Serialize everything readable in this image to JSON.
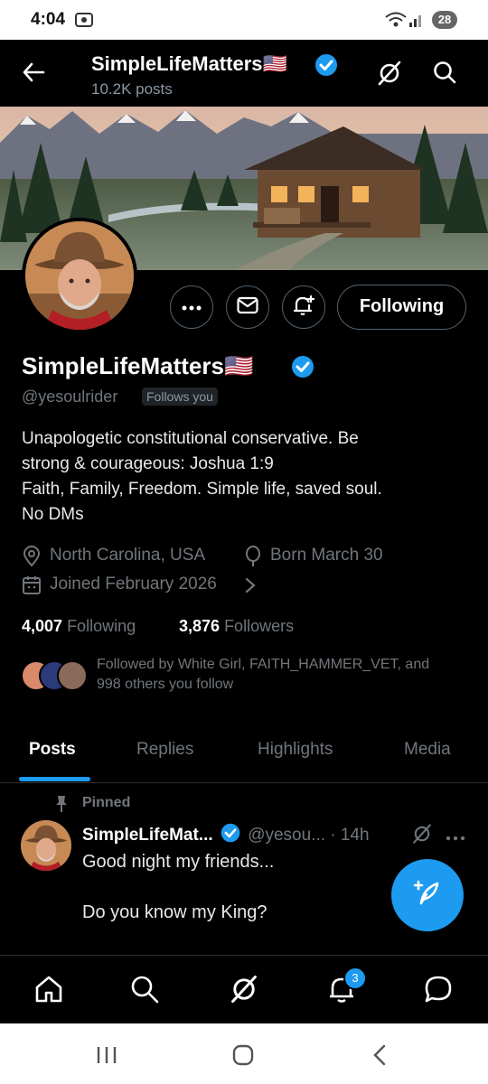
{
  "status_bar": {
    "time": "4:04",
    "battery": "28"
  },
  "header": {
    "title": "SimpleLifeMatters🇺🇸",
    "posts_count": "10.2K posts"
  },
  "profile": {
    "display_name": "SimpleLifeMatters🇺🇸",
    "handle": "@yesoulrider",
    "follows_you": "Follows you",
    "following_button": "Following",
    "bio": [
      "Unapologetic constitutional conservative. Be",
      "strong & courageous: Joshua 1:9",
      "Faith, Family, Freedom. Simple life, saved soul.",
      "No DMs"
    ],
    "location": "North Carolina, USA",
    "birthday": "Born March 30",
    "joined": "Joined February 2026",
    "following_count": "4,007",
    "following_label": "Following",
    "followers_count": "3,876",
    "followers_label": "Followers",
    "followed_by": "Followed by White Girl, FAITH_HAMMER_VET, and",
    "followed_by_2": "998 others you follow"
  },
  "tabs": [
    "Posts",
    "Replies",
    "Highlights",
    "Media"
  ],
  "post": {
    "pinned_label": "Pinned",
    "author": "SimpleLifeMat...",
    "handle": "@yesou...",
    "time": "· 14h",
    "lines": [
      "Good night my friends...",
      "",
      "Do you know my King?"
    ]
  },
  "bottom_nav": {
    "notification_count": "3"
  },
  "colors": {
    "accent": "#1d9bf0",
    "background": "#000000",
    "secondary_text": "#71767b"
  }
}
